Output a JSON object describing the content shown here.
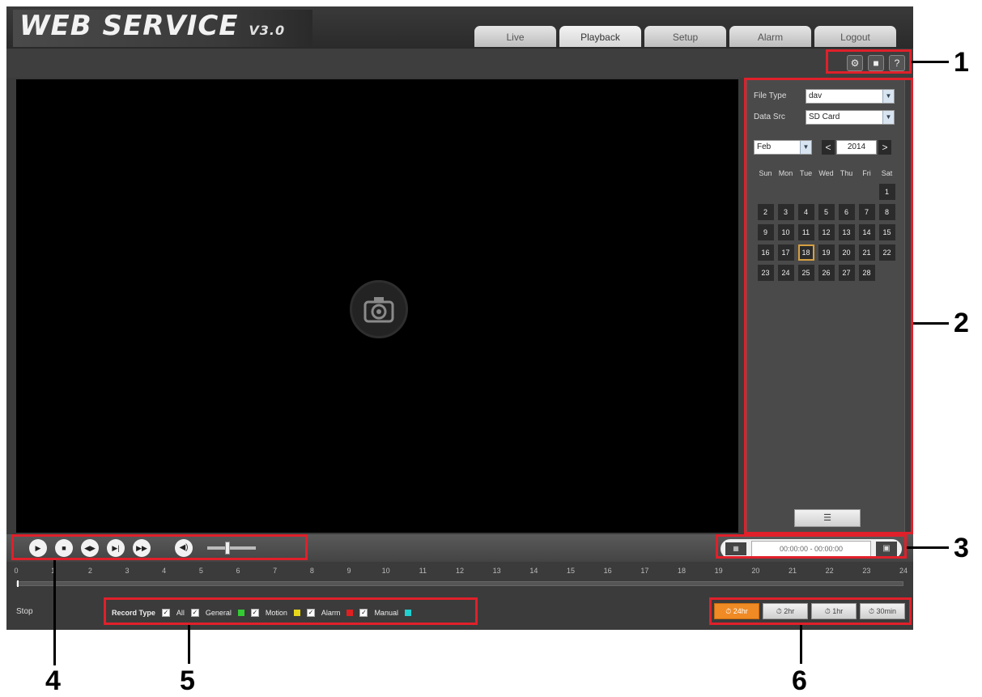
{
  "header": {
    "logo_text": "WEB SERVICE",
    "logo_version": "V3.0"
  },
  "tabs": [
    {
      "label": "Live"
    },
    {
      "label": "Playback"
    },
    {
      "label": "Setup"
    },
    {
      "label": "Alarm"
    },
    {
      "label": "Logout"
    }
  ],
  "tools": [
    {
      "icon": "gear-icon",
      "glyph": "⚙"
    },
    {
      "icon": "fullscreen-icon",
      "glyph": "■"
    },
    {
      "icon": "help-icon",
      "glyph": "?"
    }
  ],
  "panel": {
    "file_type_label": "File Type",
    "file_type_value": "dav",
    "data_src_label": "Data Src",
    "data_src_value": "SD Card",
    "month": "Feb",
    "year": "2014",
    "prev": "<",
    "next": ">",
    "weekdays": [
      "Sun",
      "Mon",
      "Tue",
      "Wed",
      "Thu",
      "Fri",
      "Sat"
    ],
    "days": [
      "1",
      "2",
      "3",
      "4",
      "5",
      "6",
      "7",
      "8",
      "9",
      "10",
      "11",
      "12",
      "13",
      "14",
      "15",
      "16",
      "17",
      "18",
      "19",
      "20",
      "21",
      "22",
      "23",
      "24",
      "25",
      "26",
      "27",
      "28"
    ],
    "selected_day": "18",
    "list_icon": "☰"
  },
  "controls": {
    "play": "▶",
    "stop": "■",
    "slow": "◀▶",
    "next_frame": "▶|",
    "fast": "▶▶",
    "volume": "◀)"
  },
  "time_range": "00:00:00 - 00:00:00",
  "timeline_ticks": [
    "0",
    "1",
    "2",
    "3",
    "4",
    "5",
    "6",
    "7",
    "8",
    "9",
    "10",
    "11",
    "12",
    "13",
    "14",
    "15",
    "16",
    "17",
    "18",
    "19",
    "20",
    "21",
    "22",
    "23",
    "24"
  ],
  "status": "Stop",
  "record_type": {
    "label": "Record Type",
    "items": [
      {
        "label": "All",
        "color": ""
      },
      {
        "label": "General",
        "color": "#33cc33"
      },
      {
        "label": "Motion",
        "color": "#e8d81a"
      },
      {
        "label": "Alarm",
        "color": "#e02020"
      },
      {
        "label": "Manual",
        "color": "#20d0d0"
      }
    ]
  },
  "zoom": [
    "24hr",
    "2hr",
    "1hr",
    "30min"
  ],
  "callouts": [
    "1",
    "2",
    "3",
    "4",
    "5",
    "6"
  ]
}
